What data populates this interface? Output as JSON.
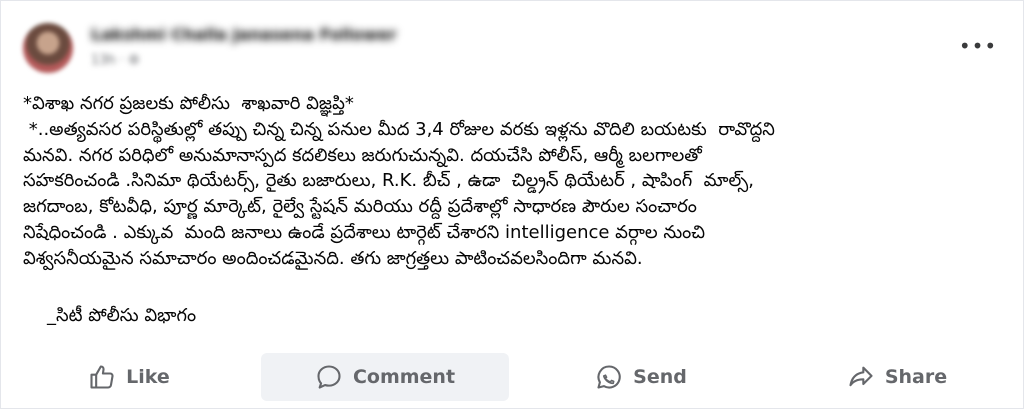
{
  "post": {
    "author": "Lakshmi Challa Janasena Follower",
    "meta": "13h · ⚙",
    "more_icon": "•••",
    "title": "*విశాఖ నగర ప్రజలకు పోలీసు  శాఖవారి విజ్ఞప్తి*",
    "lines": [
      " *..అత్యవసర పరిస్థితుల్లో తప్పు చిన్న చిన్న పనుల మీద 3,4 రోజుల వరకు ఇళ్లను వొదిలి బయటకు  రావొద్దని",
      "మనవి. నగర పరిధిలో అనుమానాస్పద కదలికలు జరుగుచున్నవి. దయచేసి పోలీస్, ఆర్మీ బలగాలతో",
      "సహకరించండి .సినిమా థియేటర్స్, రైతు బజారులు, R.K. బీచ్ , ఉడా  చిల్డ్రన్ థియేటర్ , షాపింగ్  మాల్స్,",
      "జగదాంబ, కోటవీధి, పూర్ణ మార్కెట్, రైల్వే స్టేషన్ మరియు రద్దీ ప్రదేశాల్లో సాధారణ పౌరుల సంచారం",
      "నిషేధించండి . ఎక్కువ  మంది జనాలు ఉండే ప్రదేశాలు టార్గెట్ చేశారని intelligence వర్గాల నుంచి",
      "విశ్వసనీయమైన సమాచారం అందించడమైనది. తగు జాగ్రత్తలు పాటించవలసిందిగా మనవి."
    ],
    "signature": "_సిటీ పోలీసు విభాగం"
  },
  "actions": {
    "like": "Like",
    "comment": "Comment",
    "send": "Send",
    "share": "Share"
  },
  "icons": {
    "like": "thumbs-up-icon",
    "comment": "speech-bubble-icon",
    "send": "messenger-icon",
    "share": "share-arrow-icon"
  },
  "colors": {
    "text": "#050505",
    "action_text": "#65676b",
    "hover_bg": "#f0f2f5"
  }
}
